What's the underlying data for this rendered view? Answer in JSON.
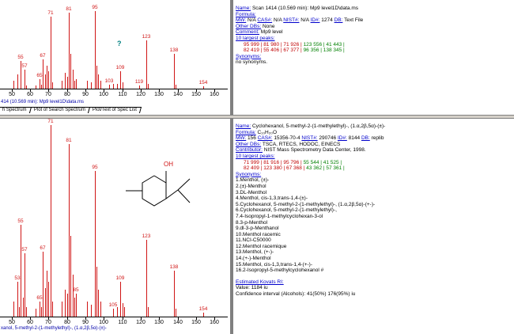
{
  "top": {
    "axis": {
      "xmin": 45,
      "xmax": 165,
      "ticks": [
        50,
        60,
        70,
        80,
        90,
        100,
        110,
        120,
        130,
        140,
        150,
        160
      ]
    },
    "peaks": [
      {
        "mz": 51,
        "h": 10
      },
      {
        "mz": 53,
        "h": 18
      },
      {
        "mz": 55,
        "h": 36,
        "label": "55"
      },
      {
        "mz": 57,
        "h": 25,
        "label": "57"
      },
      {
        "mz": 58,
        "h": 4
      },
      {
        "mz": 63,
        "h": 4
      },
      {
        "mz": 65,
        "h": 12,
        "label": "65"
      },
      {
        "mz": 66,
        "h": 5
      },
      {
        "mz": 67,
        "h": 38,
        "label": "67"
      },
      {
        "mz": 68,
        "h": 18
      },
      {
        "mz": 69,
        "h": 30
      },
      {
        "mz": 70,
        "h": 22
      },
      {
        "mz": 71,
        "h": 93,
        "label": "71"
      },
      {
        "mz": 72,
        "h": 8
      },
      {
        "mz": 77,
        "h": 10
      },
      {
        "mz": 79,
        "h": 20
      },
      {
        "mz": 80,
        "h": 15
      },
      {
        "mz": 81,
        "h": 98,
        "label": "81"
      },
      {
        "mz": 82,
        "h": 45
      },
      {
        "mz": 83,
        "h": 25
      },
      {
        "mz": 84,
        "h": 10
      },
      {
        "mz": 85,
        "h": 12
      },
      {
        "mz": 91,
        "h": 10
      },
      {
        "mz": 93,
        "h": 8
      },
      {
        "mz": 95,
        "h": 100,
        "label": "95"
      },
      {
        "mz": 96,
        "h": 30
      },
      {
        "mz": 97,
        "h": 18
      },
      {
        "mz": 98,
        "h": 10
      },
      {
        "mz": 103,
        "h": 5,
        "label": "103"
      },
      {
        "mz": 105,
        "h": 6
      },
      {
        "mz": 107,
        "h": 6
      },
      {
        "mz": 109,
        "h": 22,
        "label": "109"
      },
      {
        "mz": 110,
        "h": 8
      },
      {
        "mz": 119,
        "h": 4,
        "label": "119"
      },
      {
        "mz": 123,
        "h": 62,
        "label": "123"
      },
      {
        "mz": 124,
        "h": 6
      },
      {
        "mz": 138,
        "h": 45,
        "label": "138"
      },
      {
        "mz": 139,
        "h": 5
      },
      {
        "mz": 154,
        "h": 3,
        "label": "154"
      }
    ],
    "question_mark": "?",
    "caption": "414 (10.569 min): Mp9 level1D\\data.ms",
    "tabs": [
      "h Spectrum",
      "Plot of Search Spectrum",
      "Plot/Text of Spec List"
    ],
    "info": {
      "name_label": "Name:",
      "name_value": "Scan 1414 (10.569 min): Mp9 level1D\\data.ms",
      "formula_label": "Formula:",
      "mw_line": [
        {
          "t": "MW:",
          "link": true
        },
        {
          "t": " N/A "
        },
        {
          "t": "CAS#:",
          "link": true
        },
        {
          "t": " N/A "
        },
        {
          "t": "NIST#:",
          "link": true
        },
        {
          "t": " N/A "
        },
        {
          "t": "ID#:",
          "link": true
        },
        {
          "t": " 1274 "
        },
        {
          "t": "DB:",
          "link": true
        },
        {
          "t": " Text File"
        }
      ],
      "other_dbs_label": "Other DBs:",
      "other_dbs_value": " None",
      "comment_label": "Comment:",
      "comment_value": " Mp9 level",
      "peaks_label": "10 largest peaks:",
      "peaks_rows": [
        [
          {
            "t": "95 999 | ",
            "c": "red"
          },
          {
            "t": "81 980 | ",
            "c": "red"
          },
          {
            "t": "71 926 | ",
            "c": "red"
          },
          {
            "t": "123 556 | ",
            "c": "green"
          },
          {
            "t": "41 443 |",
            "c": "green"
          }
        ],
        [
          {
            "t": "82 419 | ",
            "c": "red"
          },
          {
            "t": "55 406 | ",
            "c": "red"
          },
          {
            "t": "67 377 | ",
            "c": "red"
          },
          {
            "t": "96 356 | ",
            "c": "green"
          },
          {
            "t": "138 345 |",
            "c": "green"
          }
        ]
      ],
      "synonyms_label": "Synonyms:",
      "synonyms_value": "no synonyms."
    }
  },
  "bottom": {
    "axis": {
      "xmin": 45,
      "xmax": 165,
      "ticks": [
        50,
        60,
        70,
        80,
        90,
        100,
        110,
        120,
        130,
        140,
        150,
        160
      ]
    },
    "peaks": [
      {
        "mz": 51,
        "h": 8
      },
      {
        "mz": 53,
        "h": 18,
        "label": "53"
      },
      {
        "mz": 54,
        "h": 5
      },
      {
        "mz": 55,
        "h": 48,
        "label": "55"
      },
      {
        "mz": 56,
        "h": 10
      },
      {
        "mz": 57,
        "h": 33,
        "label": "57"
      },
      {
        "mz": 58,
        "h": 5
      },
      {
        "mz": 63,
        "h": 4
      },
      {
        "mz": 65,
        "h": 8,
        "label": "65"
      },
      {
        "mz": 66,
        "h": 5
      },
      {
        "mz": 67,
        "h": 34,
        "label": "67"
      },
      {
        "mz": 68,
        "h": 15
      },
      {
        "mz": 69,
        "h": 24
      },
      {
        "mz": 70,
        "h": 18
      },
      {
        "mz": 71,
        "h": 100,
        "label": "71"
      },
      {
        "mz": 72,
        "h": 8
      },
      {
        "mz": 77,
        "h": 8
      },
      {
        "mz": 79,
        "h": 14
      },
      {
        "mz": 80,
        "h": 12
      },
      {
        "mz": 81,
        "h": 90,
        "label": "81"
      },
      {
        "mz": 82,
        "h": 42
      },
      {
        "mz": 83,
        "h": 22
      },
      {
        "mz": 84,
        "h": 10
      },
      {
        "mz": 85,
        "h": 12,
        "label": "85"
      },
      {
        "mz": 91,
        "h": 8
      },
      {
        "mz": 93,
        "h": 6
      },
      {
        "mz": 95,
        "h": 76,
        "label": "95"
      },
      {
        "mz": 96,
        "h": 26
      },
      {
        "mz": 97,
        "h": 14
      },
      {
        "mz": 98,
        "h": 8
      },
      {
        "mz": 105,
        "h": 4,
        "label": "105"
      },
      {
        "mz": 107,
        "h": 5
      },
      {
        "mz": 109,
        "h": 18,
        "label": "109"
      },
      {
        "mz": 110,
        "h": 7
      },
      {
        "mz": 111,
        "h": 5
      },
      {
        "mz": 123,
        "h": 40,
        "label": "123"
      },
      {
        "mz": 124,
        "h": 5
      },
      {
        "mz": 138,
        "h": 24,
        "label": "138"
      },
      {
        "mz": 139,
        "h": 4
      },
      {
        "mz": 154,
        "h": 2,
        "label": "154"
      }
    ],
    "oh_label": "OH",
    "caption": "xanol, 5-methyl-2-(1-methylethyl)-, (1.α,2β,5α)-(±)-",
    "info": {
      "name_label": "Name:",
      "name_value": "Cyclohexanol, 5-methyl-2-(1-methylethyl)-, (1.α,2β,5α)-(±)-",
      "formula_label": "Formula:",
      "formula_value": "C₁₀H₂₀O",
      "mw_line": [
        {
          "t": "MW:",
          "link": true
        },
        {
          "t": " 156 "
        },
        {
          "t": "CAS#:",
          "link": true
        },
        {
          "t": " 15356-70-4 "
        },
        {
          "t": "NIST#:",
          "link": true
        },
        {
          "t": " 290746 "
        },
        {
          "t": "ID#:",
          "link": true
        },
        {
          "t": " 8144 "
        },
        {
          "t": "DB:",
          "link": true
        },
        {
          "t": " replib"
        }
      ],
      "other_dbs_label": "Other DBs:",
      "other_dbs_value": " TSCA, RTECS, HODOC, EINECS",
      "contributor_label": "Contributor:",
      "contributor_value": " NIST Mass Spectrometry Data Center, 1998.",
      "peaks_label": "10 largest peaks:",
      "peaks_rows": [
        [
          {
            "t": "71 999 | ",
            "c": "red"
          },
          {
            "t": "81 916 | ",
            "c": "red"
          },
          {
            "t": "95 796 | ",
            "c": "red"
          },
          {
            "t": "55 544 | ",
            "c": "green"
          },
          {
            "t": "41 525 |",
            "c": "green"
          }
        ],
        [
          {
            "t": "82 409 | ",
            "c": "red"
          },
          {
            "t": "123 380 | ",
            "c": "red"
          },
          {
            "t": "67 368 | ",
            "c": "red"
          },
          {
            "t": "43 362 | ",
            "c": "green"
          },
          {
            "t": "57 361 |",
            "c": "green"
          }
        ]
      ],
      "synonyms_label": "Synonyms:",
      "synonyms": [
        "1.Menthol, (±)-",
        "2.(±)-Menthol",
        "3.DL-Menthol",
        "4.Menthol, cis-1,3,trans-1,4-(±)-",
        "5.Cyclohexanol, 5-methyl-2-(1-methylethyl)-, (1.α,2β,5α)-(+-)-",
        "6.Cyclohexanol, 5-methyl-2-(1-methylethyl)-,",
        "7.4-Isopropyl-1-methylcyclohexan-3-ol",
        "8.3-p-Menthol",
        "9.dl-3-p-Menthanol",
        "10.Menthol racemic",
        "11.NCI-C50000",
        "12.Menthol racemique",
        "13.Menthol, (+-)-",
        "14.(+-)-Menthol",
        "15.Menthol, cis-1,3,trans-1,4-(+-)-",
        "16.2-Isopropyl-5-methylcyclohexanol #"
      ],
      "kovats_label": "Estimated Kovats RI:",
      "kovats_value": "Value: 1184 iu",
      "confidence": "Confidence interval (Alcohols): 41(50%) 176(95%) iu"
    }
  }
}
